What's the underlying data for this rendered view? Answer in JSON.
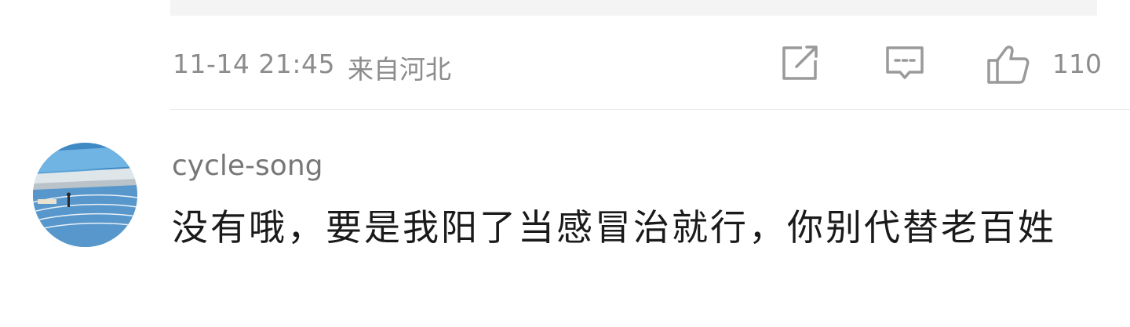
{
  "previous_comment": {
    "timestamp": "11-14 21:45",
    "location": "来自河北",
    "like_count": "110",
    "icons": {
      "share": "share-icon",
      "comment": "comment-icon",
      "like": "thumbs-up-icon"
    }
  },
  "comment": {
    "username": "cycle-song",
    "text": "没有哦，要是我阳了当感冒治就行，你别代替老百姓",
    "avatar": "stadium-track-avatar"
  },
  "colors": {
    "meta_gray": "#8c8c8c",
    "icon_gray": "#9a9a9a",
    "text": "#1a1a1a",
    "username": "#777777"
  }
}
